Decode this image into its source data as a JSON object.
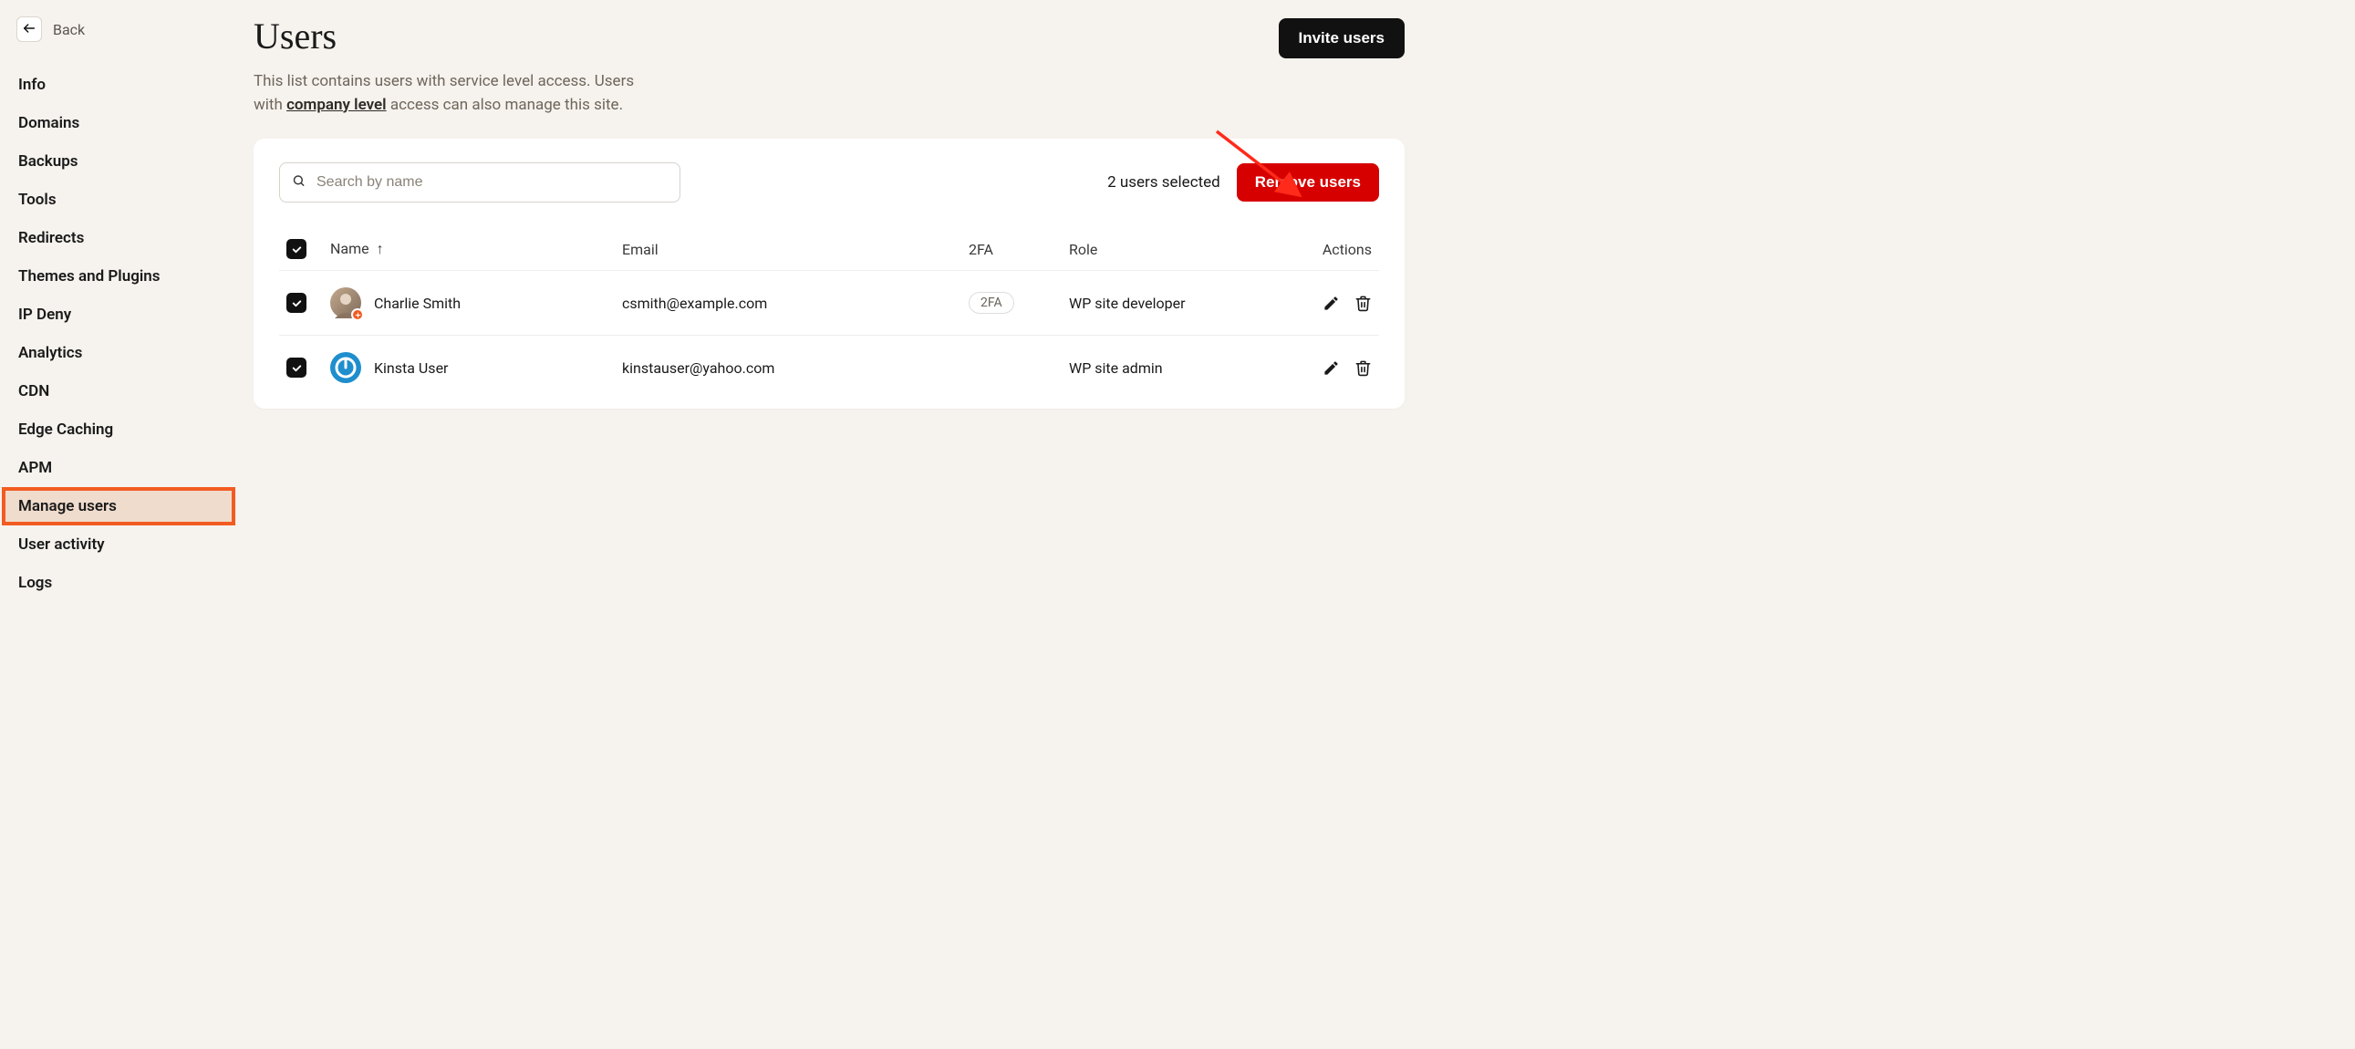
{
  "back_label": "Back",
  "sidebar": {
    "items": [
      {
        "label": "Info"
      },
      {
        "label": "Domains"
      },
      {
        "label": "Backups"
      },
      {
        "label": "Tools"
      },
      {
        "label": "Redirects"
      },
      {
        "label": "Themes and Plugins"
      },
      {
        "label": "IP Deny"
      },
      {
        "label": "Analytics"
      },
      {
        "label": "CDN"
      },
      {
        "label": "Edge Caching"
      },
      {
        "label": "APM"
      },
      {
        "label": "Manage users"
      },
      {
        "label": "User activity"
      },
      {
        "label": "Logs"
      }
    ],
    "active_index": 11
  },
  "page": {
    "title": "Users",
    "subtitle_pre": "This list contains users with service level access. Users with ",
    "subtitle_link": "company level",
    "subtitle_post": " access can also manage this site.",
    "invite_label": "Invite users"
  },
  "toolbar": {
    "search_placeholder": "Search by name",
    "selected_text": "2 users selected",
    "remove_label": "Remove users"
  },
  "table": {
    "columns": {
      "name": "Name",
      "email": "Email",
      "tfa": "2FA",
      "role": "Role",
      "actions": "Actions"
    },
    "rows": [
      {
        "checked": true,
        "avatar_type": "photo",
        "avatar_badge": true,
        "name": "Charlie Smith",
        "email": "csmith@example.com",
        "tfa": "2FA",
        "role": "WP site developer"
      },
      {
        "checked": true,
        "avatar_type": "gravatar",
        "avatar_badge": false,
        "name": "Kinsta User",
        "email": "kinstauser@yahoo.com",
        "tfa": "",
        "role": "WP site admin"
      }
    ]
  }
}
